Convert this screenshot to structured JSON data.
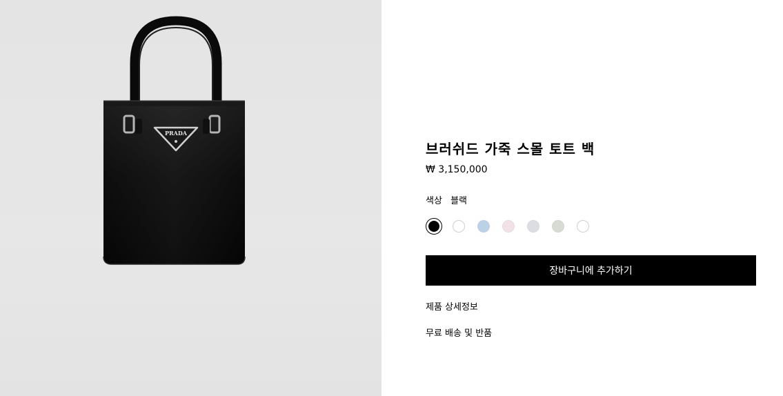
{
  "product": {
    "title": "브러쉬드 가죽 스몰 토트 백",
    "price": "₩ 3,150,000",
    "color_label": "색상",
    "color_value": "블랙",
    "logo_text": "PRADA",
    "image_name": "bag-image"
  },
  "swatches": [
    {
      "name": "black",
      "color": "#000000",
      "border": "#000000",
      "selected": true
    },
    {
      "name": "white",
      "color": "#ffffff",
      "border": "#cfcfcf",
      "selected": false
    },
    {
      "name": "light-blue",
      "color": "#bcd0e6",
      "border": "#bcd0e6",
      "selected": false
    },
    {
      "name": "pink",
      "color": "#f3e1e8",
      "border": "#eed8e1",
      "selected": false
    },
    {
      "name": "light-grey",
      "color": "#dcdde2",
      "border": "#d6d7dc",
      "selected": false
    },
    {
      "name": "sage",
      "color": "#d8dbd4",
      "border": "#d2d5ce",
      "selected": false
    },
    {
      "name": "ivory",
      "color": "#ffffff",
      "border": "#cfcfcf",
      "selected": false
    }
  ],
  "actions": {
    "add_to_cart": "장바구니에 추가하기",
    "details": "제품 상세정보",
    "shipping": "무료 배송 및 반품"
  },
  "colors": {
    "image_background": "#e5e5e5",
    "button_background": "#000000",
    "button_text": "#ffffff"
  }
}
